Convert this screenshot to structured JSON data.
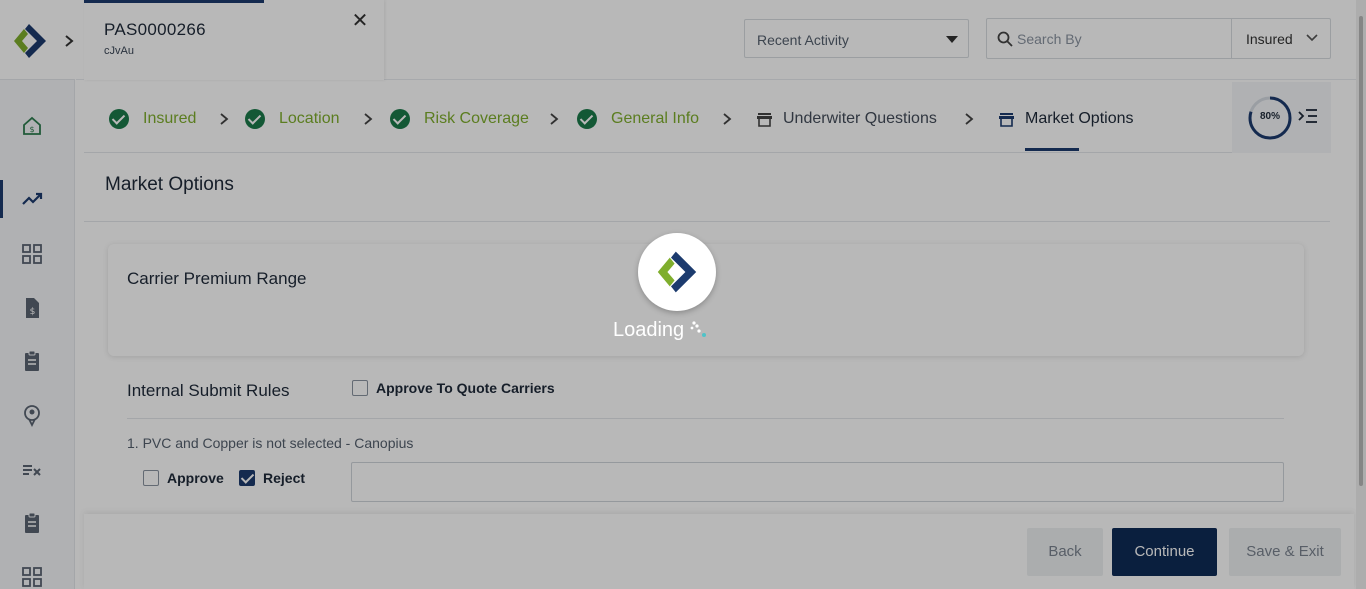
{
  "policy": {
    "id": "PAS0000266",
    "subtitle": "cJvAu",
    "close_label": "✕"
  },
  "header": {
    "recent_activity_label": "Recent Activity",
    "search_placeholder": "Search By",
    "search_scope": "Insured"
  },
  "steps": [
    {
      "label": "Insured",
      "status": "done"
    },
    {
      "label": "Location",
      "status": "done"
    },
    {
      "label": "Risk Coverage",
      "status": "done"
    },
    {
      "label": "General Info",
      "status": "done"
    },
    {
      "label": "Underwiter Questions",
      "status": "pending"
    },
    {
      "label": "Market Options",
      "status": "current"
    }
  ],
  "progress": {
    "label": "80%",
    "value": 0.8
  },
  "page": {
    "title": "Market Options"
  },
  "premium_card": {
    "title": "Carrier Premium Range"
  },
  "internal_rules": {
    "title": "Internal Submit Rules",
    "approve_to_quote_label": "Approve To Quote Carriers",
    "approve_to_quote_checked": false,
    "rules": [
      {
        "text": "1. PVC and Copper is not selected - Canopius",
        "approve_label": "Approve",
        "approve_checked": false,
        "reject_label": "Reject",
        "reject_checked": true,
        "comment": ""
      }
    ]
  },
  "footer": {
    "back_label": "Back",
    "continue_label": "Continue",
    "save_exit_label": "Save & Exit"
  },
  "loader": {
    "text": "Loading"
  },
  "colors": {
    "brand_navy": "#1c3b6e",
    "brand_green": "#7fae2d",
    "check_green": "#1b7a4a",
    "continue_bg": "#0f2b57"
  },
  "sidebar": {
    "icons": [
      "home-icon",
      "trending-up-icon",
      "dashboard-grid-icon",
      "document-dollar-icon",
      "clipboard-icon",
      "location-pin-icon",
      "checklist-icon",
      "clipboard-list-icon",
      "apps-grid-icon"
    ],
    "active_icon": "trending-up-icon"
  }
}
